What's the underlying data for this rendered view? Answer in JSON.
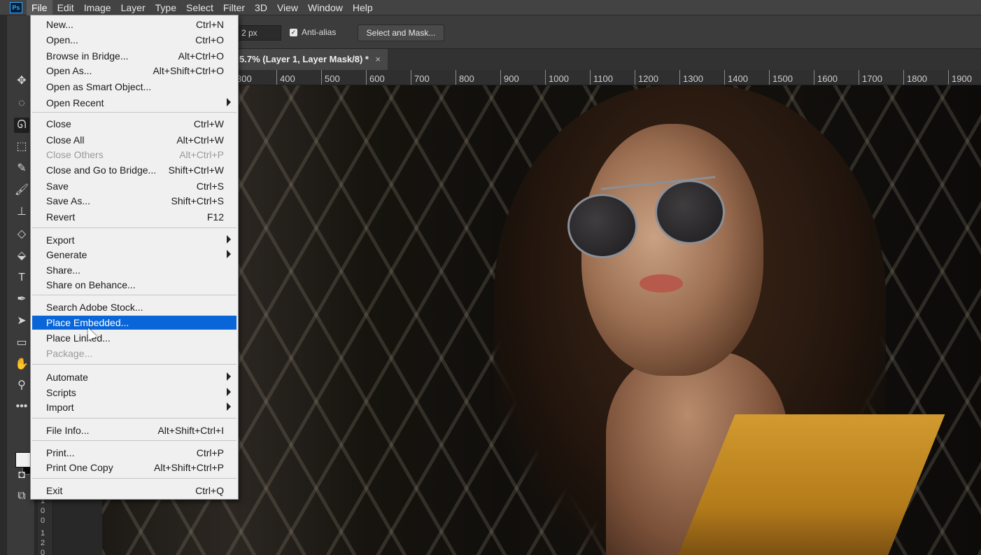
{
  "app": {
    "logo": "Ps"
  },
  "menubar": {
    "items": [
      "File",
      "Edit",
      "Image",
      "Layer",
      "Type",
      "Select",
      "Filter",
      "3D",
      "View",
      "Window",
      "Help"
    ],
    "active": "File"
  },
  "options": {
    "feather_value": "2 px",
    "antialias_label": "Anti-alias",
    "antialias_checked": true,
    "select_mask_label": "Select and Mask..."
  },
  "document": {
    "tab_title": "5.7% (Layer 1, Layer Mask/8) *",
    "close_glyph": "×"
  },
  "ruler": {
    "ticks": [
      "300",
      "400",
      "500",
      "600",
      "700",
      "800",
      "900",
      "1000",
      "1100",
      "1200",
      "1300",
      "1400",
      "1500",
      "1600",
      "1700",
      "1800",
      "1900"
    ],
    "vertical_digits": [
      "1",
      "0",
      "0",
      "1",
      "2",
      "0"
    ]
  },
  "file_menu": {
    "items": [
      {
        "label": "New...",
        "shortcut": "Ctrl+N"
      },
      {
        "label": "Open...",
        "shortcut": "Ctrl+O"
      },
      {
        "label": "Browse in Bridge...",
        "shortcut": "Alt+Ctrl+O"
      },
      {
        "label": "Open As...",
        "shortcut": "Alt+Shift+Ctrl+O"
      },
      {
        "label": "Open as Smart Object...",
        "shortcut": ""
      },
      {
        "label": "Open Recent",
        "shortcut": "",
        "submenu": true
      },
      {
        "label": "Close",
        "shortcut": "Ctrl+W"
      },
      {
        "label": "Close All",
        "shortcut": "Alt+Ctrl+W"
      },
      {
        "label": "Close Others",
        "shortcut": "Alt+Ctrl+P",
        "disabled": true
      },
      {
        "label": "Close and Go to Bridge...",
        "shortcut": "Shift+Ctrl+W"
      },
      {
        "label": "Save",
        "shortcut": "Ctrl+S"
      },
      {
        "label": "Save As...",
        "shortcut": "Shift+Ctrl+S"
      },
      {
        "label": "Revert",
        "shortcut": "F12"
      },
      {
        "label": "Export",
        "shortcut": "",
        "submenu": true
      },
      {
        "label": "Generate",
        "shortcut": "",
        "submenu": true
      },
      {
        "label": "Share...",
        "shortcut": ""
      },
      {
        "label": "Share on Behance...",
        "shortcut": ""
      },
      {
        "label": "Search Adobe Stock...",
        "shortcut": ""
      },
      {
        "label": "Place Embedded...",
        "shortcut": "",
        "highlighted": true
      },
      {
        "label": "Place Linked...",
        "shortcut": ""
      },
      {
        "label": "Package...",
        "shortcut": "",
        "disabled": true
      },
      {
        "label": "Automate",
        "shortcut": "",
        "submenu": true
      },
      {
        "label": "Scripts",
        "shortcut": "",
        "submenu": true
      },
      {
        "label": "Import",
        "shortcut": "",
        "submenu": true
      },
      {
        "label": "File Info...",
        "shortcut": "Alt+Shift+Ctrl+I"
      },
      {
        "label": "Print...",
        "shortcut": "Ctrl+P"
      },
      {
        "label": "Print One Copy",
        "shortcut": "Alt+Shift+Ctrl+P"
      },
      {
        "label": "Exit",
        "shortcut": "Ctrl+Q"
      }
    ]
  },
  "toolbar": {
    "tools": [
      "move-icon",
      "marquee-icon",
      "lasso-icon",
      "object-select-icon",
      "eyedropper-icon",
      "brush-icon",
      "stamp-icon",
      "eraser-icon",
      "paint-bucket-icon",
      "type-icon",
      "pen-icon",
      "path-select-icon",
      "rectangle-icon",
      "hand-icon",
      "zoom-icon",
      "more-tools-icon"
    ],
    "selected_tool": "lasso-icon"
  },
  "colors": {
    "menu_highlight": "#0a66d8",
    "app_chrome": "#3c3c3c",
    "menu_bg": "#f0f0f0"
  }
}
